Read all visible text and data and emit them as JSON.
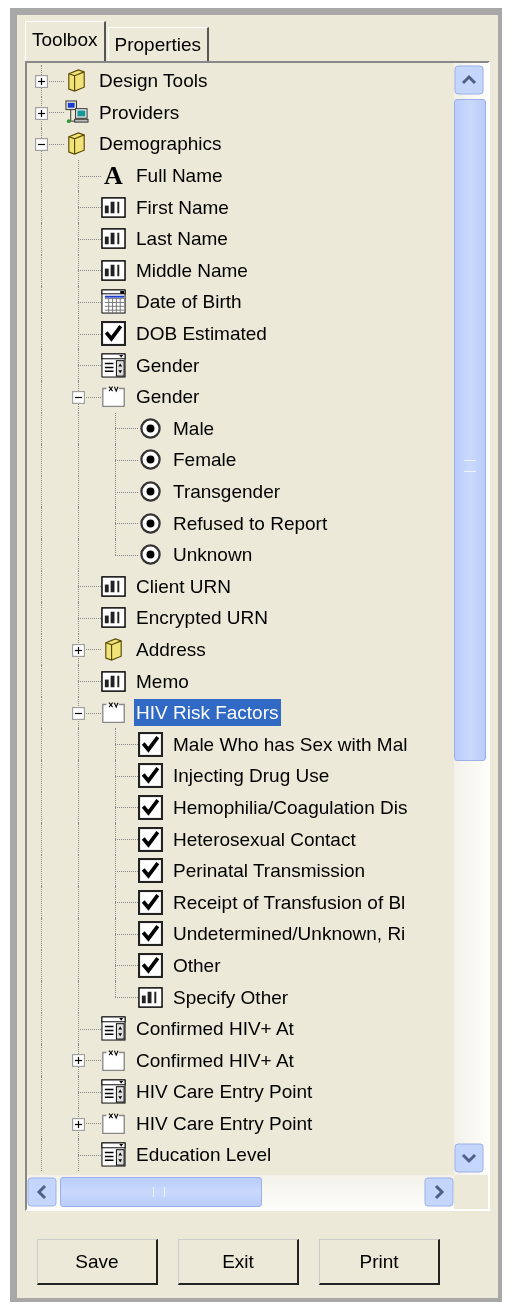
{
  "tabs": [
    {
      "label": "Toolbox",
      "selected": true
    },
    {
      "label": "Properties",
      "selected": false
    }
  ],
  "tree": {
    "items": [
      {
        "label": "Design Tools",
        "kind": "folder",
        "expanded": false,
        "selected": false
      },
      {
        "label": "Providers",
        "kind": "network",
        "expanded": false,
        "selected": false
      },
      {
        "label": "Demographics",
        "kind": "folder",
        "expanded": true,
        "selected": false,
        "children": [
          {
            "label": "Full Name",
            "kind": "font",
            "glyph": "A",
            "selected": false
          },
          {
            "label": "First Name",
            "kind": "textbox",
            "selected": false
          },
          {
            "label": "Last Name",
            "kind": "textbox",
            "selected": false
          },
          {
            "label": "Middle Name",
            "kind": "textbox",
            "selected": false
          },
          {
            "label": "Date of Birth",
            "kind": "calendar",
            "selected": false
          },
          {
            "label": "DOB Estimated",
            "kind": "checkbox",
            "checked": true,
            "selected": false
          },
          {
            "label": "Gender",
            "kind": "combo",
            "selected": false
          },
          {
            "label": "Gender",
            "kind": "group",
            "expanded": true,
            "selected": false,
            "children": [
              {
                "label": "Male",
                "kind": "radio",
                "selected": false
              },
              {
                "label": "Female",
                "kind": "radio",
                "selected": false
              },
              {
                "label": "Transgender",
                "kind": "radio",
                "selected": false
              },
              {
                "label": "Refused to Report",
                "kind": "radio",
                "selected": false
              },
              {
                "label": "Unknown",
                "kind": "radio",
                "selected": false
              }
            ]
          },
          {
            "label": "Client URN",
            "kind": "textbox",
            "selected": false
          },
          {
            "label": "Encrypted URN",
            "kind": "textbox",
            "selected": false
          },
          {
            "label": "Address",
            "kind": "folder",
            "expanded": false,
            "selected": false
          },
          {
            "label": "Memo",
            "kind": "textbox",
            "selected": false
          },
          {
            "label": "HIV Risk Factors",
            "kind": "group",
            "expanded": true,
            "selected": true,
            "children": [
              {
                "label": "Male Who has Sex with Mal",
                "kind": "checkbox",
                "checked": true,
                "selected": false
              },
              {
                "label": "Injecting Drug Use",
                "kind": "checkbox",
                "checked": true,
                "selected": false
              },
              {
                "label": "Hemophilia/Coagulation Dis",
                "kind": "checkbox",
                "checked": true,
                "selected": false
              },
              {
                "label": "Heterosexual Contact",
                "kind": "checkbox",
                "checked": true,
                "selected": false
              },
              {
                "label": "Perinatal Transmission",
                "kind": "checkbox",
                "checked": true,
                "selected": false
              },
              {
                "label": "Receipt of Transfusion of Bl",
                "kind": "checkbox",
                "checked": true,
                "selected": false
              },
              {
                "label": "Undetermined/Unknown, Ri",
                "kind": "checkbox",
                "checked": true,
                "selected": false
              },
              {
                "label": "Other",
                "kind": "checkbox",
                "checked": true,
                "selected": false
              },
              {
                "label": "Specify Other",
                "kind": "textbox",
                "selected": false
              }
            ]
          },
          {
            "label": "Confirmed HIV+ At",
            "kind": "combo",
            "selected": false
          },
          {
            "label": "Confirmed HIV+ At",
            "kind": "group",
            "expanded": false,
            "selected": false
          },
          {
            "label": "HIV Care Entry Point",
            "kind": "combo",
            "selected": false
          },
          {
            "label": "HIV Care Entry Point",
            "kind": "group",
            "expanded": false,
            "selected": false
          },
          {
            "label": "Education Level",
            "kind": "combo",
            "selected": false
          }
        ]
      }
    ]
  },
  "buttons": [
    "Save",
    "Exit",
    "Print"
  ]
}
